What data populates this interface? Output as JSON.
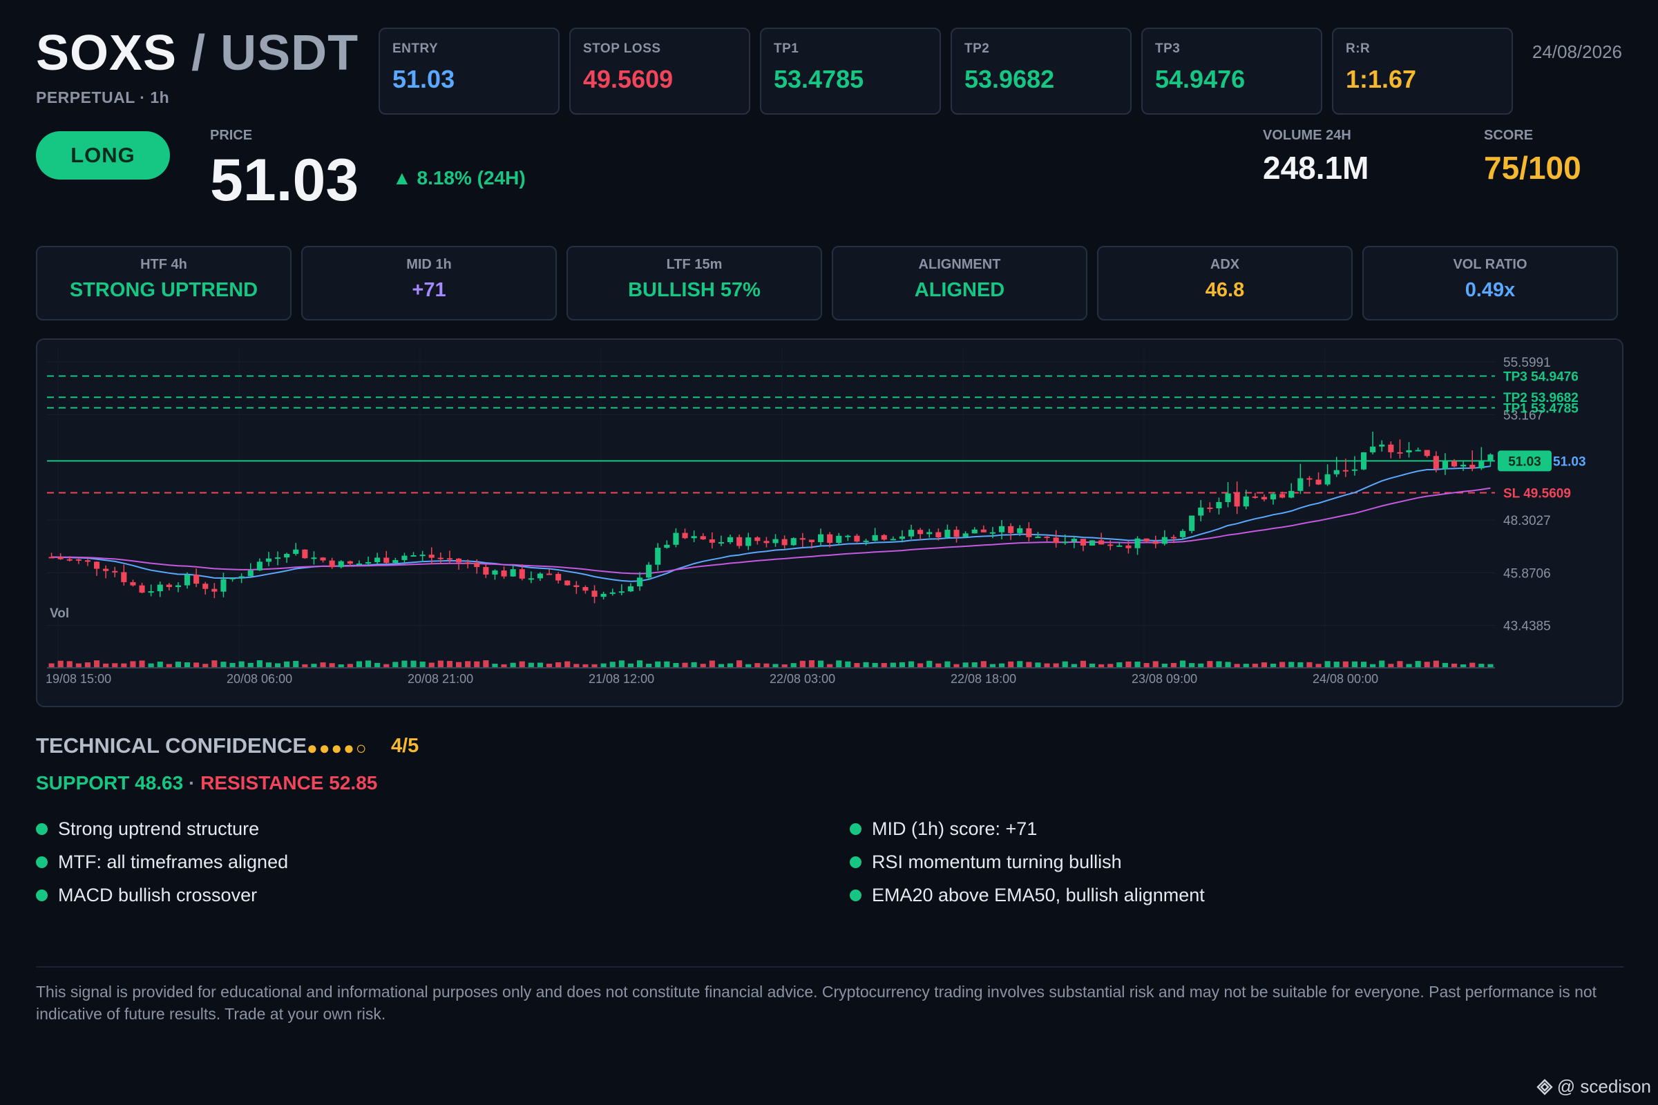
{
  "header": {
    "base": "SOXS",
    "sep": "/",
    "quote": "USDT",
    "subtitle": "PERPETUAL · 1h",
    "date": "24/08/2026"
  },
  "stats": [
    {
      "label": "ENTRY",
      "value": "51.03",
      "color": "#5aa8ff"
    },
    {
      "label": "STOP LOSS",
      "value": "49.5609",
      "color": "#f0455a"
    },
    {
      "label": "TP1",
      "value": "53.4785",
      "color": "#16c784"
    },
    {
      "label": "TP2",
      "value": "53.9682",
      "color": "#16c784"
    },
    {
      "label": "TP3",
      "value": "54.9476",
      "color": "#16c784"
    },
    {
      "label": "R:R",
      "value": "1:1.67",
      "color": "#f5b82e"
    }
  ],
  "signal": {
    "direction": "LONG",
    "price_label": "PRICE",
    "price": "51.03",
    "change": "▲ 8.18% (24H)",
    "volume_label": "VOLUME 24H",
    "volume": "248.1M",
    "score_label": "SCORE",
    "score": "75/100"
  },
  "indicators": [
    {
      "label": "HTF 4h",
      "value": "STRONG UPTREND",
      "color": "#16c784"
    },
    {
      "label": "MID 1h",
      "value": "+71",
      "color": "#a58bff"
    },
    {
      "label": "LTF 15m",
      "value": "BULLISH 57%",
      "color": "#16c784"
    },
    {
      "label": "ALIGNMENT",
      "value": "ALIGNED",
      "color": "#16c784"
    },
    {
      "label": "ADX",
      "value": "46.8",
      "color": "#f5b82e"
    },
    {
      "label": "VOL RATIO",
      "value": "0.49x",
      "color": "#5aa8ff"
    }
  ],
  "chart_data": {
    "type": "candlestick",
    "y_ticks": [
      "55.5991",
      "53.167",
      "48.3027",
      "45.8706",
      "43.4385"
    ],
    "x_ticks": [
      "19/08 15:00",
      "20/08 06:00",
      "20/08 21:00",
      "21/08 12:00",
      "22/08 03:00",
      "22/08 18:00",
      "23/08 09:00",
      "24/08 00:00"
    ],
    "volume_label": "Vol",
    "levels": [
      {
        "name": "TP3",
        "label": "TP3 54.9476",
        "value": 54.9476,
        "color": "#16c784",
        "style": "dashed"
      },
      {
        "name": "TP2",
        "label": "TP2 53.9682",
        "value": 53.9682,
        "color": "#16c784",
        "style": "dashed"
      },
      {
        "name": "TP1",
        "label": "TP1 53.4785",
        "value": 53.4785,
        "color": "#16c784",
        "style": "dashed"
      },
      {
        "name": "Entry",
        "label": "51.03",
        "value": 51.03,
        "color": "#16c784",
        "style": "solid"
      },
      {
        "name": "SL",
        "label": "SL 49.5609",
        "value": 49.5609,
        "color": "#f0455a",
        "style": "dashed"
      }
    ],
    "last_price": "51.03",
    "ylim": [
      42.6,
      56.3
    ],
    "colors": {
      "up": "#16c784",
      "down": "#f0455a",
      "ema20": "#5aa8ff",
      "ema50": "#c55ae0"
    }
  },
  "confidence": {
    "title": "TECHNICAL CONFIDENCE",
    "dots": "●●●●○",
    "score": "4/5",
    "support": "SUPPORT 48.63",
    "separator": " · ",
    "resistance": "RESISTANCE 52.85"
  },
  "reasons_left": [
    "Strong uptrend structure",
    "MTF: all timeframes aligned",
    "MACD bullish crossover"
  ],
  "reasons_right": [
    "MID (1h) score: +71",
    "RSI momentum turning bullish",
    "EMA20 above EMA50, bullish alignment"
  ],
  "disclaimer": "This signal is provided for educational and informational purposes only and does not constitute financial advice. Cryptocurrency trading involves substantial risk and may not be suitable for everyone. Past performance is not indicative of future results. Trade at your own risk.",
  "watermark": "@ scedison"
}
